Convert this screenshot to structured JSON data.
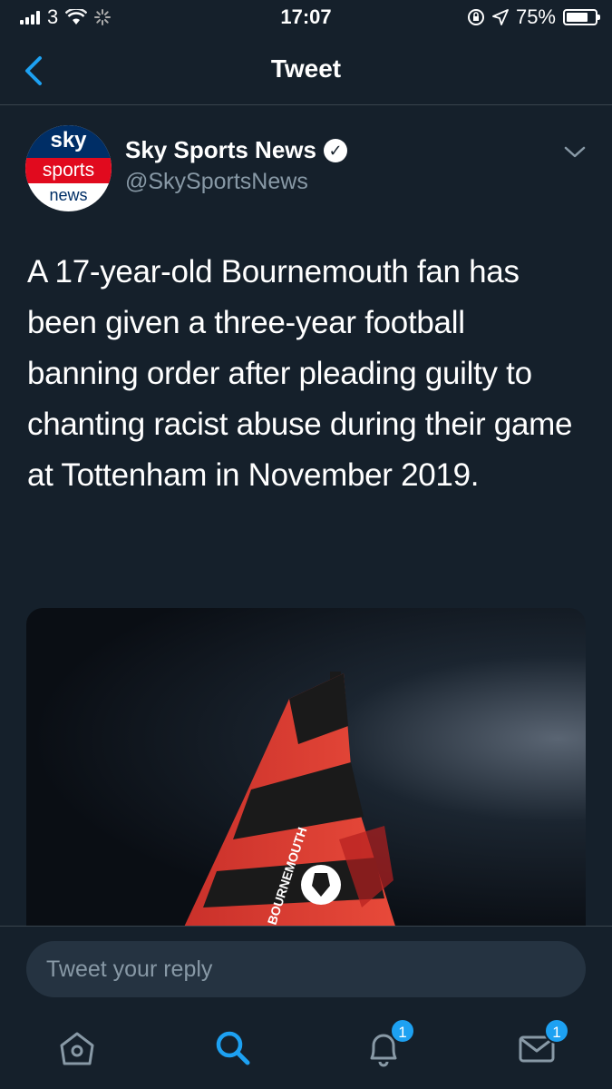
{
  "status_bar": {
    "carrier": "3",
    "time": "17:07",
    "battery": "75%",
    "battery_level": 0.75
  },
  "nav": {
    "title": "Tweet"
  },
  "tweet": {
    "display_name": "Sky Sports News",
    "handle": "@SkySportsNews",
    "avatar": {
      "line1": "sky",
      "line2": "sports",
      "line3": "news"
    },
    "text": "A 17-year-old Bournemouth fan has been given a three-year football banning order after pleading guilty to chanting racist abuse during their game at Tottenham in November 2019.",
    "media_label": "BOURNEMOUTH"
  },
  "reply": {
    "placeholder": "Tweet your reply"
  },
  "tabs": {
    "notifications_badge": "1",
    "messages_badge": "1"
  },
  "colors": {
    "background": "#15202b",
    "accent": "#1da1f2",
    "secondary_text": "#8899a6"
  }
}
